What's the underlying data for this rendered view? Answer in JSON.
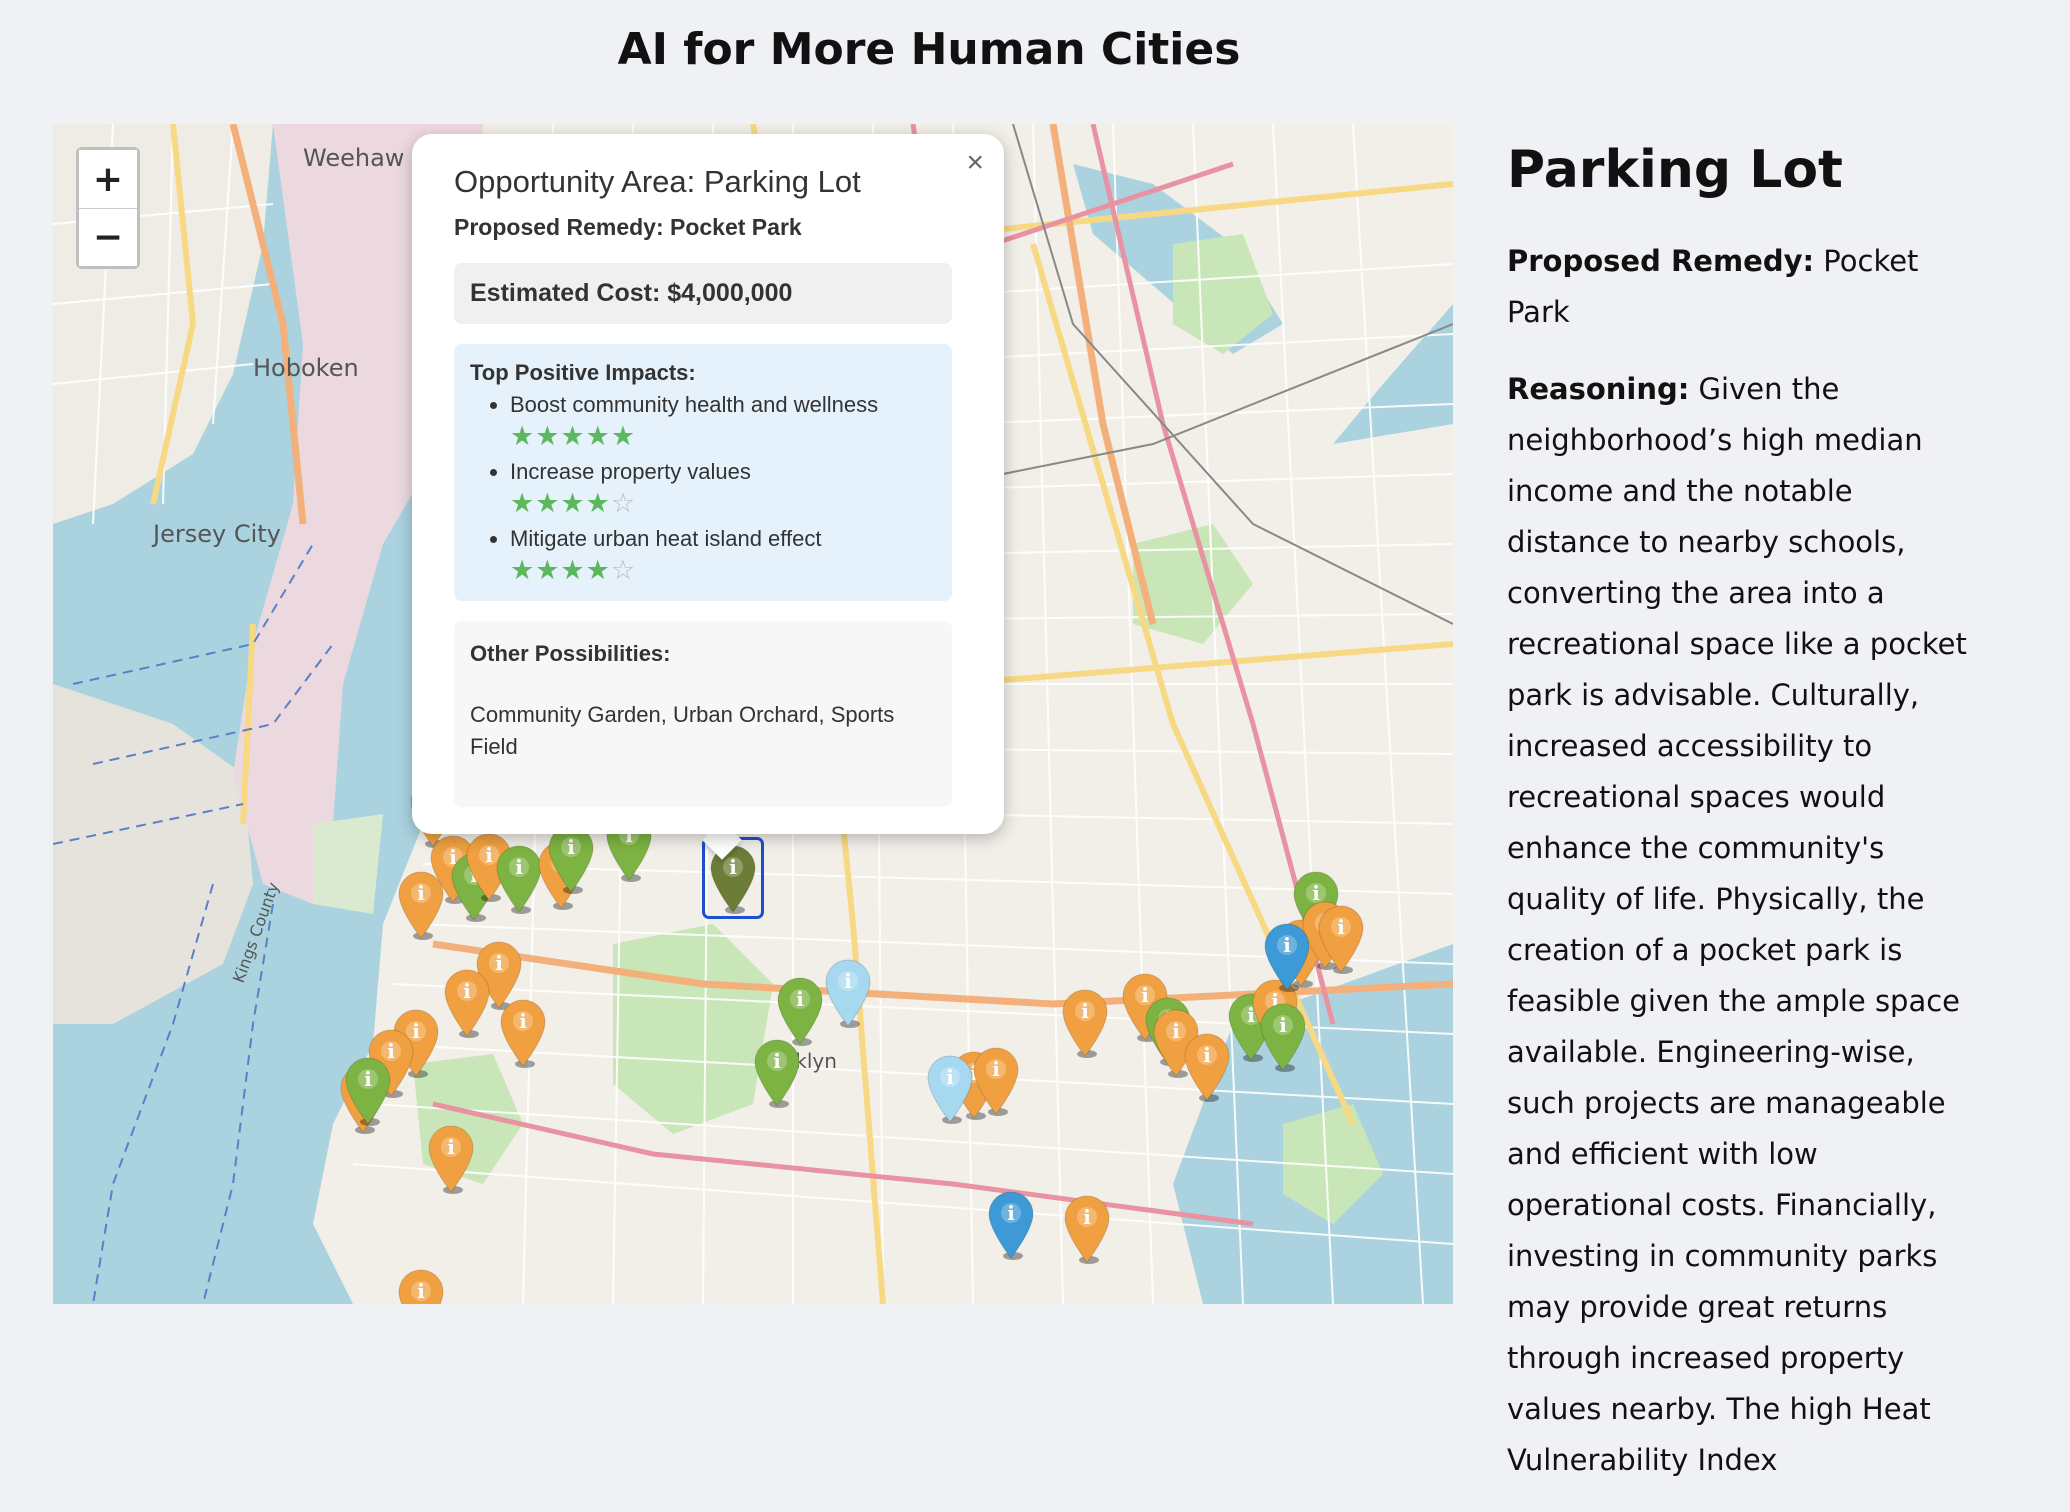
{
  "page": {
    "title": "AI for More Human Cities"
  },
  "map": {
    "zoom_in": "+",
    "zoom_out": "−",
    "place_labels": [
      {
        "name": "Hoboken"
      },
      {
        "name": "Jersey City"
      },
      {
        "name": "Weehaw"
      },
      {
        "name": "Kings County"
      },
      {
        "name": "oklyn"
      }
    ],
    "marker_icon": "info-icon",
    "colors": {
      "water": "#aad3df",
      "land": "#f2efe9",
      "park": "#c8e6b8",
      "orange_marker": "#f0a040",
      "green_marker": "#7cb342",
      "light_blue_marker": "#a6d8f0",
      "blue_marker": "#3d9ad6",
      "selected_marker": "#6b7d36",
      "selection_outline": "#1f4fd1"
    }
  },
  "popup": {
    "close_label": "×",
    "title": "Opportunity Area: Parking Lot",
    "remedy": "Proposed Remedy: Pocket Park",
    "cost": "Estimated Cost: $4,000,000",
    "impacts_header": "Top Positive Impacts:",
    "impacts": [
      {
        "label": "Boost community health and wellness",
        "rating": 5
      },
      {
        "label": "Increase property values",
        "rating": 4
      },
      {
        "label": "Mitigate urban heat island effect",
        "rating": 4
      }
    ],
    "others_header": "Other Possibilities:",
    "others_text": "Community Garden, Urban Orchard, Sports Field"
  },
  "side": {
    "title": "Parking Lot",
    "remedy_label": "Proposed Remedy:",
    "remedy_value": " Pocket Park",
    "reasoning_label": "Reasoning:",
    "reasoning_text": " Given the neighborhood’s high median income and the notable distance to nearby schools, converting the area into a recreational space like a pocket park is advisable. Culturally, increased accessibility to recreational spaces would enhance the community's quality of life. Physically, the creation of a pocket park is feasible given the ample space available. Engineering-wise, such projects are manageable and efficient with low operational costs. Financially, investing in community parks may provide great returns through increased property values nearby. The high Heat Vulnerability Index"
  }
}
